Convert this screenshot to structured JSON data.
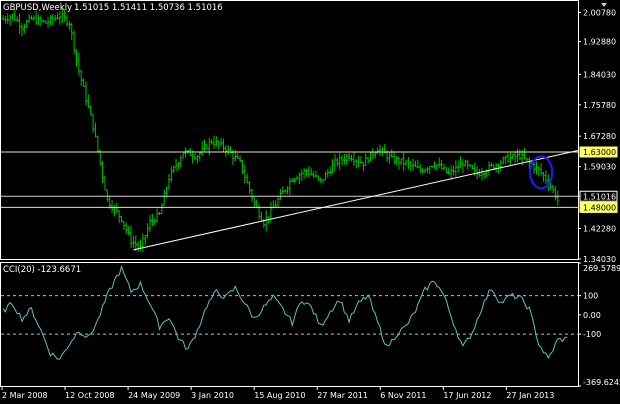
{
  "header": {
    "symbol_tf": "GBPUSD,Weekly",
    "ohlc": "1.51015 1.51411 1.50736 1.51016"
  },
  "indicator": {
    "label": "CCI(20) -123.6671"
  },
  "colors": {
    "background": "#000000",
    "frame": "#ffffff",
    "bars": "#00c000",
    "cci_line": "#5fbfbf",
    "hline": "#e8e8a0",
    "trendline": "#ffffff",
    "circle": "#1a1aff",
    "badge": "#ffff66"
  },
  "chart_data": [
    {
      "type": "bar",
      "subtype": "ohlc",
      "title": "GBPUSD,Weekly",
      "ylim": [
        1.3403,
        2.0388
      ],
      "ytick_labels": [
        "2.00780",
        "1.92880",
        "1.84030",
        "1.75780",
        "1.67280",
        "1.59030",
        "1.51016",
        "1.42280",
        "1.34030"
      ],
      "ytick_values": [
        2.0078,
        1.9288,
        1.8403,
        1.7578,
        1.6728,
        1.5903,
        1.51016,
        1.4228,
        1.3403
      ],
      "xtick_labels": [
        "2 Mar 2008",
        "12 Oct 2008",
        "24 May 2009",
        "3 Jan 2010",
        "15 Aug 2010",
        "27 Mar 2011",
        "6 Nov 2011",
        "17 Jun 2012",
        "27 Jan 2013"
      ],
      "price_path": [
        [
          0,
          1.99
        ],
        [
          4,
          2.0
        ],
        [
          8,
          1.97
        ],
        [
          12,
          1.99
        ],
        [
          18,
          1.98
        ],
        [
          24,
          2.0
        ],
        [
          28,
          1.98
        ],
        [
          32,
          1.85
        ],
        [
          38,
          1.7
        ],
        [
          44,
          1.5
        ],
        [
          50,
          1.45
        ],
        [
          54,
          1.39
        ],
        [
          58,
          1.37
        ],
        [
          62,
          1.44
        ],
        [
          66,
          1.46
        ],
        [
          70,
          1.56
        ],
        [
          76,
          1.63
        ],
        [
          82,
          1.62
        ],
        [
          88,
          1.66
        ],
        [
          94,
          1.64
        ],
        [
          100,
          1.6
        ],
        [
          106,
          1.49
        ],
        [
          110,
          1.44
        ],
        [
          116,
          1.5
        ],
        [
          122,
          1.56
        ],
        [
          128,
          1.58
        ],
        [
          134,
          1.55
        ],
        [
          140,
          1.6
        ],
        [
          146,
          1.62
        ],
        [
          152,
          1.6
        ],
        [
          158,
          1.64
        ],
        [
          164,
          1.61
        ],
        [
          170,
          1.6
        ],
        [
          176,
          1.58
        ],
        [
          182,
          1.6
        ],
        [
          188,
          1.57
        ],
        [
          194,
          1.6
        ],
        [
          200,
          1.57
        ],
        [
          206,
          1.59
        ],
        [
          212,
          1.61
        ],
        [
          218,
          1.62
        ],
        [
          222,
          1.6
        ],
        [
          226,
          1.58
        ],
        [
          230,
          1.55
        ],
        [
          234,
          1.5
        ]
      ],
      "horizontal_levels": [
        {
          "value": 1.63,
          "label": "1.63000",
          "highlight": true
        },
        {
          "value": 1.51016,
          "label": "1.51016",
          "highlight": false
        },
        {
          "value": 1.48,
          "label": "1.48000",
          "highlight": true
        }
      ],
      "trendline": {
        "from": [
          55,
          1.365
        ],
        "to": [
          240,
          1.626
        ]
      },
      "ellipse_center": [
        227,
        1.575
      ]
    },
    {
      "type": "line",
      "title": "CCI(20) -123.6671",
      "ylim": [
        -369.6245,
        269.5789
      ],
      "ytick_labels": [
        "269.5789",
        "100",
        "0.00",
        "-100",
        "-369.6245"
      ],
      "ytick_values": [
        269.5789,
        100,
        0,
        -100,
        -369.6245
      ],
      "levels": [
        100,
        -100
      ],
      "path": [
        [
          0,
          20
        ],
        [
          4,
          60
        ],
        [
          8,
          -20
        ],
        [
          12,
          30
        ],
        [
          16,
          -80
        ],
        [
          20,
          -200
        ],
        [
          24,
          -230
        ],
        [
          28,
          -150
        ],
        [
          32,
          -80
        ],
        [
          36,
          -120
        ],
        [
          40,
          -30
        ],
        [
          44,
          100
        ],
        [
          48,
          200
        ],
        [
          50,
          240
        ],
        [
          54,
          120
        ],
        [
          58,
          160
        ],
        [
          62,
          60
        ],
        [
          66,
          -60
        ],
        [
          70,
          -10
        ],
        [
          74,
          -120
        ],
        [
          78,
          -180
        ],
        [
          82,
          -80
        ],
        [
          86,
          50
        ],
        [
          90,
          120
        ],
        [
          94,
          90
        ],
        [
          98,
          140
        ],
        [
          102,
          60
        ],
        [
          106,
          -20
        ],
        [
          110,
          40
        ],
        [
          114,
          90
        ],
        [
          118,
          30
        ],
        [
          122,
          -40
        ],
        [
          126,
          80
        ],
        [
          130,
          40
        ],
        [
          134,
          -60
        ],
        [
          138,
          20
        ],
        [
          142,
          80
        ],
        [
          146,
          -30
        ],
        [
          150,
          60
        ],
        [
          154,
          100
        ],
        [
          158,
          -40
        ],
        [
          162,
          -170
        ],
        [
          166,
          -100
        ],
        [
          170,
          -60
        ],
        [
          174,
          20
        ],
        [
          178,
          130
        ],
        [
          182,
          180
        ],
        [
          186,
          100
        ],
        [
          190,
          -40
        ],
        [
          194,
          -170
        ],
        [
          198,
          -90
        ],
        [
          202,
          40
        ],
        [
          206,
          140
        ],
        [
          210,
          60
        ],
        [
          214,
          100
        ],
        [
          218,
          90
        ],
        [
          222,
          30
        ],
        [
          226,
          -150
        ],
        [
          230,
          -230
        ],
        [
          234,
          -130
        ],
        [
          238,
          -124
        ]
      ]
    }
  ]
}
